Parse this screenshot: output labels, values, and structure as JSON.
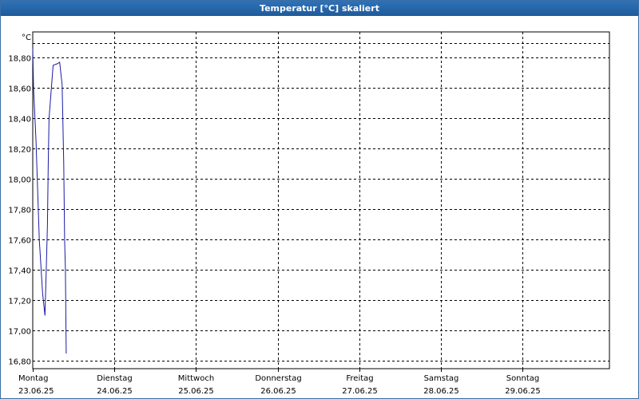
{
  "window": {
    "title": "Temperatur [°C] skaliert"
  },
  "colors": {
    "line": "#1a1aa6",
    "grid": "#000000",
    "title_bar": "#1e5a9a"
  },
  "chart_data": {
    "type": "line",
    "title": "Temperatur [°C] skaliert",
    "ylabel": "°C",
    "xlabel": "",
    "ylim": [
      16.75,
      18.97
    ],
    "y_ticks": [
      16.8,
      17.0,
      17.2,
      17.4,
      17.6,
      17.8,
      18.0,
      18.2,
      18.4,
      18.6,
      18.8
    ],
    "y_tick_labels": [
      "16,80",
      "17,00",
      "17,20",
      "17,40",
      "17,60",
      "17,80",
      "18,00",
      "18,20",
      "18,40",
      "18,60",
      "18,80"
    ],
    "x_ticks": [
      {
        "day": "Montag",
        "date": "23.06.25"
      },
      {
        "day": "Dienstag",
        "date": "24.06.25"
      },
      {
        "day": "Mittwoch",
        "date": "25.06.25"
      },
      {
        "day": "Donnerstag",
        "date": "26.06.25"
      },
      {
        "day": "Freitag",
        "date": "27.06.25"
      },
      {
        "day": "Samstag",
        "date": "28.06.25"
      },
      {
        "day": "Sonntag",
        "date": "29.06.25"
      }
    ],
    "grid": true,
    "series": [
      {
        "values_x": [
          0.0,
          0.01,
          0.04,
          0.08,
          0.12,
          0.15,
          0.17,
          0.18,
          0.19,
          0.2,
          0.25,
          0.3,
          0.33,
          0.36,
          0.38,
          0.39,
          0.4,
          0.41
        ],
        "values_y": [
          18.86,
          18.6,
          18.25,
          17.6,
          17.25,
          17.1,
          17.5,
          17.7,
          18.1,
          18.4,
          18.75,
          18.76,
          18.77,
          18.62,
          18.1,
          17.6,
          17.4,
          16.85
        ]
      }
    ]
  }
}
